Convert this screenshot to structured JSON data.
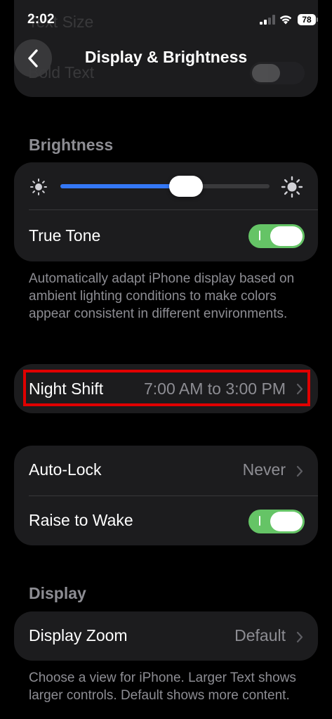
{
  "status_bar": {
    "time": "2:02",
    "battery": "78"
  },
  "ghost": {
    "line1": "Text Size",
    "line2": "Bold Text"
  },
  "nav": {
    "title": "Display & Brightness"
  },
  "brightness": {
    "header": "Brightness",
    "level": 0.6,
    "true_tone_label": "True Tone",
    "true_tone_on": true,
    "footer": "Automatically adapt iPhone display based on ambient lighting conditions to make colors appear consistent in different environments."
  },
  "night_shift": {
    "label": "Night Shift",
    "value": "7:00 AM to 3:00 PM"
  },
  "lock": {
    "auto_lock_label": "Auto-Lock",
    "auto_lock_value": "Never",
    "raise_label": "Raise to Wake",
    "raise_on": true
  },
  "display": {
    "header": "Display",
    "zoom_label": "Display Zoom",
    "zoom_value": "Default",
    "footer": "Choose a view for iPhone. Larger Text shows larger controls. Default shows more content."
  },
  "colors": {
    "background": "#000000",
    "card": "#1c1c1e",
    "accent_blue": "#3478f6",
    "toggle_green": "#65c466",
    "secondary_text": "#8d8d93",
    "highlight_red": "#e00000"
  },
  "icons": {
    "back": "chevron-left-icon",
    "disclosure": "chevron-right-icon",
    "brightness_low": "sun-small-icon",
    "brightness_high": "sun-large-icon"
  }
}
